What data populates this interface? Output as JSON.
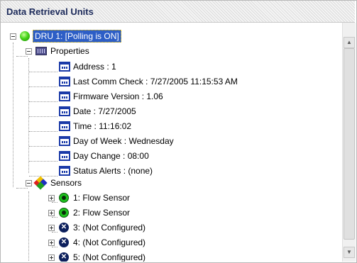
{
  "panel": {
    "title": "Data Retrieval Units"
  },
  "tree": {
    "root": {
      "label": "DRU 1: [Polling is ON]"
    },
    "properties": {
      "label": "Properties",
      "items": [
        "Address : 1",
        "Last Comm Check : 7/27/2005 11:15:53 AM",
        "Firmware Version : 1.06",
        "Date : 7/27/2005",
        "Time : 11:16:02",
        "Day of Week : Wednesday",
        "Day Change : 08:00",
        "Status Alerts : (none)"
      ]
    },
    "sensors": {
      "label": "Sensors",
      "items": [
        {
          "label": "1: Flow Sensor",
          "icon": "flow-sensor-icon"
        },
        {
          "label": "2: Flow Sensor",
          "icon": "flow-sensor-icon"
        },
        {
          "label": "3: (Not Configured)",
          "icon": "not-configured-icon"
        },
        {
          "label": "4: (Not Configured)",
          "icon": "not-configured-icon"
        },
        {
          "label": "5: (Not Configured)",
          "icon": "not-configured-icon"
        }
      ]
    }
  },
  "scrollbar": {
    "up_glyph": "▲",
    "down_glyph": "▼"
  },
  "colors": {
    "selection": "#2d5ec6",
    "title_text": "#1c2a5a"
  }
}
